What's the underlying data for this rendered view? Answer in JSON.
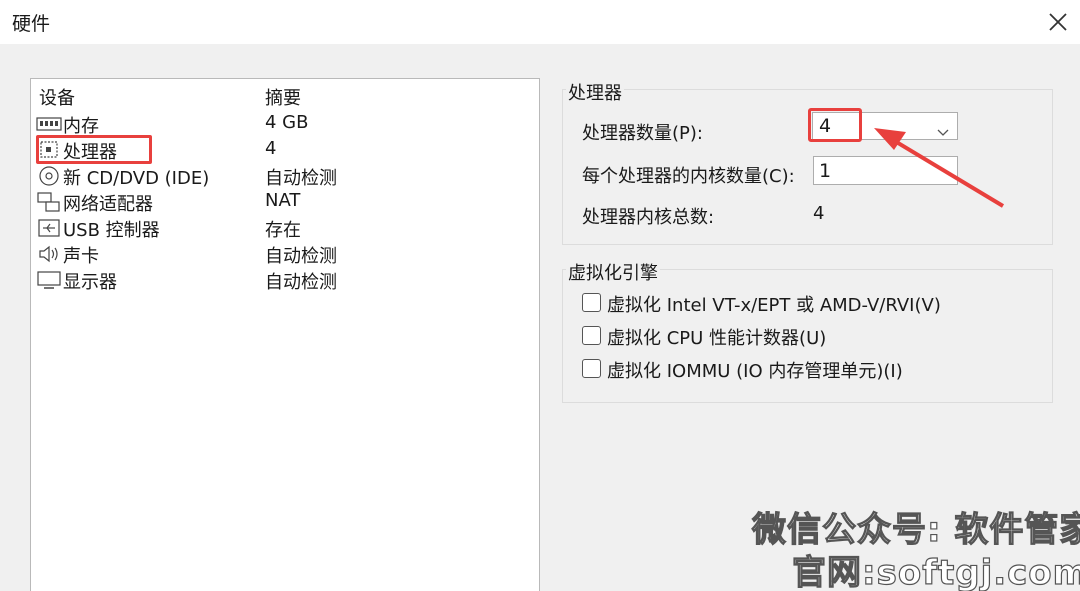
{
  "window": {
    "title": "硬件",
    "close_icon": "close-icon"
  },
  "device_list": {
    "headers": {
      "device": "设备",
      "summary": "摘要"
    },
    "rows": [
      {
        "icon": "memory-icon",
        "name": "内存",
        "summary": "4 GB"
      },
      {
        "icon": "processor-icon",
        "name": "处理器",
        "summary": "4"
      },
      {
        "icon": "cd-dvd-icon",
        "name": "新 CD/DVD (IDE)",
        "summary": "自动检测"
      },
      {
        "icon": "network-adapter-icon",
        "name": "网络适配器",
        "summary": "NAT"
      },
      {
        "icon": "usb-icon",
        "name": "USB 控制器",
        "summary": "存在"
      },
      {
        "icon": "sound-card-icon",
        "name": "声卡",
        "summary": "自动检测"
      },
      {
        "icon": "display-icon",
        "name": "显示器",
        "summary": "自动检测"
      }
    ]
  },
  "processor_group": {
    "title": "处理器",
    "count_label": "处理器数量(P):",
    "count_value": "4",
    "cores_label": "每个处理器的内核数量(C):",
    "cores_value": "1",
    "total_label": "处理器内核总数:",
    "total_value": "4"
  },
  "virtualization_group": {
    "title": "虚拟化引擎",
    "options": [
      {
        "label": "虚拟化 Intel VT-x/EPT 或 AMD-V/RVI(V)",
        "checked": false
      },
      {
        "label": "虚拟化 CPU 性能计数器(U)",
        "checked": false
      },
      {
        "label": "虚拟化 IOMMU (IO 内存管理单元)(I)",
        "checked": false
      }
    ]
  },
  "watermark": {
    "line1": "微信公众号: 软件管家",
    "line2": "官网:softgj.com"
  },
  "colors": {
    "highlight": "#e8403d"
  }
}
